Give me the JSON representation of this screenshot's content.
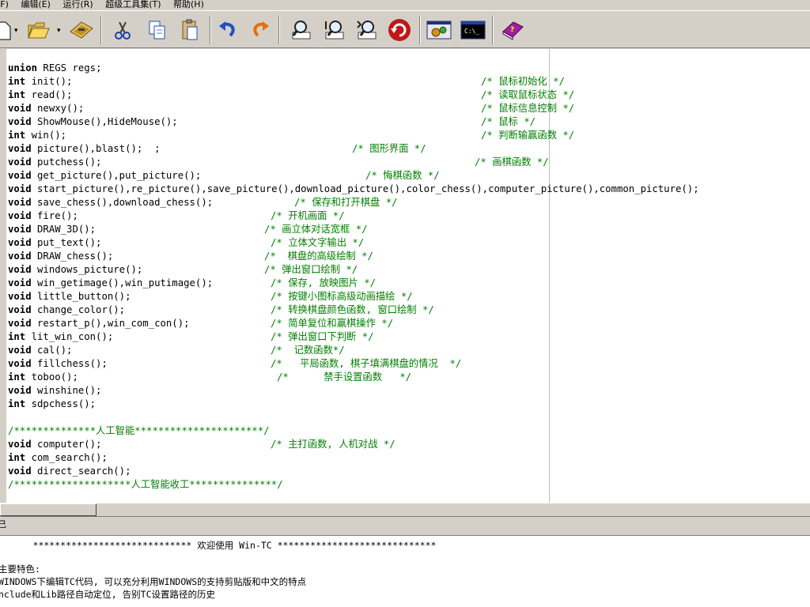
{
  "menu": [
    "(F)",
    "编辑(E)",
    "运行(R)",
    "超级工具集(T)",
    "帮助(H)"
  ],
  "toolbar": {
    "buttons": [
      {
        "name": "new-file-button",
        "icon": "new-file-icon"
      },
      {
        "name": "open-file-button",
        "icon": "folder-open-icon"
      },
      {
        "name": "save-file-button",
        "icon": "save-disk-icon"
      },
      {
        "name": "cut-button",
        "icon": "scissors-icon"
      },
      {
        "name": "copy-button",
        "icon": "copy-icon"
      },
      {
        "name": "paste-button",
        "icon": "paste-icon"
      },
      {
        "name": "undo-button",
        "icon": "undo-icon"
      },
      {
        "name": "redo-button",
        "icon": "redo-icon"
      },
      {
        "name": "find-button",
        "icon": "find-icon"
      },
      {
        "name": "find-next-button",
        "icon": "find-next-icon"
      },
      {
        "name": "replace-button",
        "icon": "replace-icon"
      },
      {
        "name": "refresh-button",
        "icon": "refresh-icon"
      },
      {
        "name": "compile-button",
        "icon": "compile-gears-icon"
      },
      {
        "name": "console-button",
        "icon": "console-icon"
      },
      {
        "name": "help-book-button",
        "icon": "help-book-icon"
      }
    ]
  },
  "editor": {
    "lines": [
      {
        "kw": "union",
        "code": " REGS regs;",
        "comment": ""
      },
      {
        "kw": "int",
        "code": " init();",
        "comment": "/* 鼠标初始化 */",
        "col": 598
      },
      {
        "kw": "int",
        "code": " read();",
        "comment": "/* 读取鼠标状态 */",
        "col": 598
      },
      {
        "kw": "void",
        "code": " newxy();",
        "comment": "/* 鼠标信息控制 */",
        "col": 598
      },
      {
        "kw": "void",
        "code": " ShowMouse(),HideMouse();",
        "comment": "/* 鼠标 */",
        "col": 598
      },
      {
        "kw": "int",
        "code": " win();",
        "comment": "/* 判断输赢函数 */",
        "col": 598
      },
      {
        "kw": "void",
        "code": " picture(),blast();  ;",
        "comment": "/* 图形界面 */",
        "col": 435
      },
      {
        "kw": "void",
        "code": " putchess();",
        "comment": "/* 画棋函数 */",
        "col": 590
      },
      {
        "kw": "void",
        "code": " get_picture(),put_picture();",
        "comment": "/* 悔棋函数 */",
        "col": 452
      },
      {
        "kw": "void",
        "code": " start_picture(),re_picture(),save_picture(),download_picture(),color_chess(),computer_picture(),common_picture();",
        "comment": ""
      },
      {
        "kw": "void",
        "code": " save_chess(),download_chess();",
        "comment": "/* 保存和打开棋盘 */",
        "col": 362
      },
      {
        "kw": "void",
        "code": " fire();",
        "comment": "/* 开机画面 */",
        "col": 332
      },
      {
        "kw": "void",
        "code": " DRAW_3D();",
        "comment": "/* 画立体对话宽框 */",
        "col": 324
      },
      {
        "kw": "void",
        "code": " put_text();",
        "comment": "/* 立体文字输出 */",
        "col": 332
      },
      {
        "kw": "void",
        "code": " DRAW_chess();",
        "comment": "/*  棋盘的高级绘制 */",
        "col": 324
      },
      {
        "kw": "void",
        "code": " windows_picture();",
        "comment": "/* 弹出窗口绘制 */",
        "col": 324
      },
      {
        "kw": "void",
        "code": " win_getimage(),win_putimage();",
        "comment": "/* 保存, 放映图片 */",
        "col": 332
      },
      {
        "kw": "void",
        "code": " little_button();",
        "comment": "/* 按键小图标高级动画描绘 */",
        "col": 332
      },
      {
        "kw": "void",
        "code": " change_color();",
        "comment": "/* 转换棋盘颜色函数, 窗口绘制 */",
        "col": 332
      },
      {
        "kw": "void",
        "code": " restart_p(),win_com_con();",
        "comment": "/* 简单复位和赢棋操作 */",
        "col": 332
      },
      {
        "kw": "int",
        "code": " lit_win_con();",
        "comment": "/* 弹出窗口下判断 */",
        "col": 332
      },
      {
        "kw": "void",
        "code": " cal();",
        "comment": "/*  记数函数*/",
        "col": 332
      },
      {
        "kw": "void",
        "code": " fillchess();",
        "comment": "/*   平局函数, 棋子填满棋盘的情况  */",
        "col": 332
      },
      {
        "kw": "int",
        "code": " toboo();",
        "comment": "/*      禁手设置函数   */",
        "col": 340
      },
      {
        "kw": "void",
        "code": " winshine();",
        "comment": ""
      },
      {
        "kw": "int",
        "code": " sdpchess();",
        "comment": ""
      },
      {
        "kw": "",
        "code": "",
        "comment": ""
      },
      {
        "kw": "",
        "code": "",
        "comment": "/**************人工智能**********************/",
        "col": 0
      },
      {
        "kw": "void",
        "code": " computer();",
        "comment": "/* 主打函数, 人机对战 */",
        "col": 332
      },
      {
        "kw": "int",
        "code": " com_search();",
        "comment": ""
      },
      {
        "kw": "void",
        "code": " direct_search();",
        "comment": ""
      },
      {
        "kw": "",
        "code": "",
        "comment": "/********************人工智能收工***************/",
        "col": 0
      }
    ]
  },
  "splitter_label": "己",
  "output": {
    "lines": [
      "      ***************************** 欢迎使用 Win-TC *****************************",
      "",
      "主要特色:",
      "WINDOWS下编辑TC代码, 可以充分利用WINDOWS的支持剪贴版和中文的特点",
      "nclude和Lib路径自动定位, 告别TC设置路径的历史"
    ]
  }
}
